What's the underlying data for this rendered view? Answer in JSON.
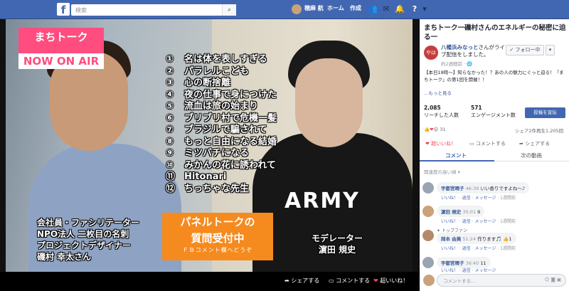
{
  "topbar": {
    "logo": "f",
    "search_placeholder": "検索",
    "user_name": "穂麻 航",
    "nav_home": "ホーム",
    "nav_create": "作成",
    "icons": [
      "friends-icon",
      "messenger-icon",
      "notifications-icon",
      "help-icon",
      "menu-icon"
    ]
  },
  "video": {
    "badge_line1": "まちトーク",
    "badge_line2": "NOW  ON AIR",
    "topics": [
      {
        "num": "①",
        "text": "名は体を表しすぎる"
      },
      {
        "num": "②",
        "text": "パラレルこども"
      },
      {
        "num": "③",
        "text": "心の断捨離"
      },
      {
        "num": "④",
        "text": "夜の仕事で身につけた"
      },
      {
        "num": "⑤",
        "text": "流血は旅の始まり"
      },
      {
        "num": "⑥",
        "text": "ブリブリ村で危機一髪"
      },
      {
        "num": "⑦",
        "text": "ブラジルで騙されて"
      },
      {
        "num": "⑧",
        "text": "もっと自由になる結婚"
      },
      {
        "num": "⑨",
        "text": "ミツバチになる"
      },
      {
        "num": "⑩",
        "text": "みかんの花に誘われて"
      },
      {
        "num": "⑪",
        "text": "Hitonari"
      },
      {
        "num": "⑫",
        "text": "ちっちゃな先生"
      }
    ],
    "speaker_lines": [
      "会社員・ファシリテーター",
      "NPO法人 二枚目の名刺",
      "プロジェクトデザイナー",
      "磯村 幸太さん"
    ],
    "moderator_lines": [
      "モデレーター",
      "濵田 規史"
    ],
    "panel_title_1": "パネルトークの",
    "panel_title_2": "質問受付中",
    "panel_sub": "ＦＢコメント欄へどうぞ",
    "shirt_text": "ARMY",
    "bar_share": "シェアする",
    "bar_comment": "コメントする",
    "bar_like": "超いいね！"
  },
  "sidebar": {
    "title": "まちトーク一磯村さんのエネルギーの秘密に迫る一",
    "page_logo": "やはた",
    "page_name": "八幡浜みなっと",
    "page_action": "さんがライブ配信をしました。",
    "follow": "フォロー中",
    "more": "▾",
    "post_time": "約2週間前 · ",
    "post_text": "【本日18時〜】知らなかった！？あの人の魅力にぐっと迫る！「まちトーク」の第1回を開催！！",
    "see_more": "…もっと見る",
    "reach_num": "2,085",
    "reach_label": "リーチした人数",
    "eng_num": "571",
    "eng_label": "エンゲージメント数",
    "promote": "投稿を宣伝",
    "reactions_count": "31",
    "shares": "シェア2件",
    "plays": "再生1,205回",
    "act_like": "超いいね！",
    "act_comment": "コメントする",
    "act_share": "シェアする",
    "tab_comments": "コメント",
    "tab_next": "次の動画",
    "sort": "関連度の高い順 ▾",
    "comments": [
      {
        "name": "宇都宮晴子",
        "time": "46:39",
        "text": "いい香りですよね〜♪",
        "meta_time": "1週間前"
      },
      {
        "name": "濵田 規史",
        "time": "35:01",
        "text": "9",
        "meta_time": "1週間前"
      },
      {
        "name": "岡本 由美",
        "time": "51:24",
        "text": "作ります🎵",
        "meta_time": "1週間前",
        "fan": "トップファン",
        "likes": "1"
      },
      {
        "name": "宇都宮晴子",
        "time": "36:40",
        "text": "11",
        "meta_time": ""
      }
    ],
    "meta_like": "いいね！",
    "meta_reply": "返信",
    "meta_message": "メッセージ",
    "input_placeholder": "コメントする..."
  }
}
